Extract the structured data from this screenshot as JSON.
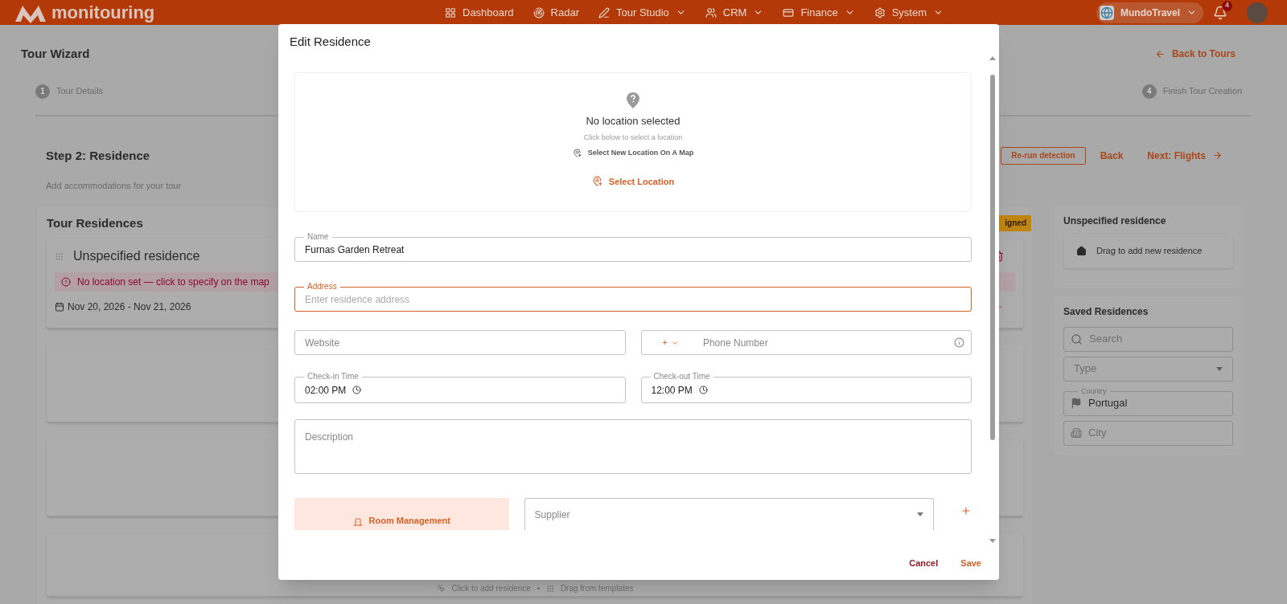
{
  "nav": {
    "brand": "monitouring",
    "items": [
      {
        "kind": "link",
        "label": "Dashboard"
      },
      {
        "kind": "link",
        "label": "Radar"
      },
      {
        "kind": "dropdown",
        "label": "Tour Studio"
      },
      {
        "kind": "dropdown",
        "label": "CRM"
      },
      {
        "kind": "dropdown",
        "label": "Finance"
      },
      {
        "kind": "dropdown",
        "label": "System"
      }
    ],
    "account": "MundoTravel",
    "notifications": "4"
  },
  "page": {
    "title": "Tour Wizard",
    "back_link": "Back to Tours",
    "steps": [
      {
        "number": "1",
        "label": "Tour Details"
      },
      {
        "number": "4",
        "label": "Finish Tour Creation"
      }
    ],
    "step_title": "Step 2: Residence",
    "step_subtitle": "Add accommodations for your tour",
    "actions": {
      "rerun": "Re-run detection",
      "back": "Back",
      "next": "Next: Flights"
    },
    "residences": {
      "title": "Tour Residences",
      "badge": "igned",
      "card": {
        "name": "Unspecified residence",
        "warning": "No location set — click to specify on the map",
        "dates": "Nov 20, 2026 - Nov 21, 2026"
      },
      "hint": {
        "click": "Click to add residence",
        "drag": "Drag from templates"
      }
    },
    "side": {
      "unspecified_title": "Unspecified residence",
      "drag_tile": "Drag to add new residence",
      "saved_title": "Saved Residences",
      "search_placeholder": "Search",
      "type_placeholder": "Type",
      "country_label": "Country",
      "country_value": "Portugal",
      "city_placeholder": "City"
    }
  },
  "dialog": {
    "title": "Edit Residence",
    "location": {
      "heading": "No location selected",
      "hint": "Click below to select a location",
      "map_link": "Select New Location On A Map",
      "button": "Select Location"
    },
    "name": {
      "label": "Name",
      "value": "Furnas Garden Retreat"
    },
    "address": {
      "label": "Address",
      "placeholder": "Enter residence address",
      "focused": true
    },
    "website": {
      "placeholder": "Website"
    },
    "phone": {
      "code": "+",
      "placeholder": "Phone Number"
    },
    "check_in": {
      "label": "Check-in Time",
      "value": "02:00 PM"
    },
    "check_out": {
      "label": "Check-out Time",
      "value": "12:00 PM"
    },
    "description": {
      "placeholder": "Description"
    },
    "room_button": "Room Management",
    "supplier": {
      "placeholder": "Supplier"
    },
    "buttons": {
      "cancel": "Cancel",
      "save": "Save"
    }
  }
}
